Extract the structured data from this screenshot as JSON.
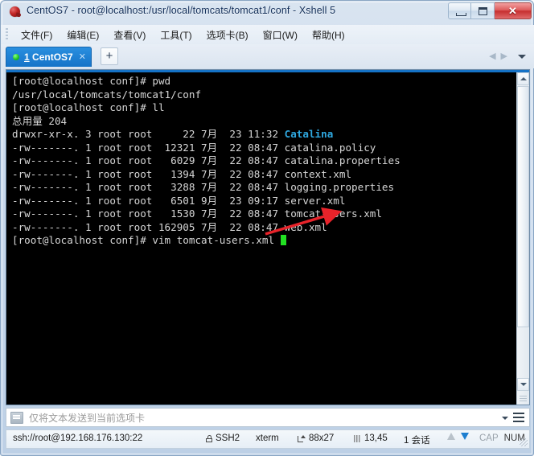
{
  "window": {
    "title": "CentOS7 - root@localhost:/usr/local/tomcats/tomcat1/conf - Xshell 5",
    "icon": "xshell-icon",
    "controls": {
      "minimize": "minimize-button",
      "maximize": "maximize-button",
      "close_label": "✕"
    }
  },
  "menubar": {
    "items": [
      {
        "label": "文件(F)"
      },
      {
        "label": "编辑(E)"
      },
      {
        "label": "查看(V)"
      },
      {
        "label": "工具(T)"
      },
      {
        "label": "选项卡(B)"
      },
      {
        "label": "窗口(W)"
      },
      {
        "label": "帮助(H)"
      }
    ]
  },
  "tabbar": {
    "tabs": [
      {
        "index": "1",
        "label": " CentOS7",
        "close_glyph": "✕",
        "active": true
      }
    ],
    "add_tab_label": "+",
    "nav_prev": "◀",
    "nav_next": "▶"
  },
  "terminal": {
    "lines": [
      "[root@localhost conf]# pwd",
      "/usr/local/tomcats/tomcat1/conf",
      "[root@localhost conf]# ll",
      "总用量 204",
      "drwxr-xr-x. 3 root root     22 7月  23 11:32 ",
      "-rw-------. 1 root root  12321 7月  22 08:47 catalina.policy",
      "-rw-------. 1 root root   6029 7月  22 08:47 catalina.properties",
      "-rw-------. 1 root root   1394 7月  22 08:47 context.xml",
      "-rw-------. 1 root root   3288 7月  22 08:47 logging.properties",
      "-rw-------. 1 root root   6501 9月  23 09:17 server.xml",
      "-rw-------. 1 root root   1530 7月  22 08:47 tomcat-users.xml",
      "-rw-------. 1 root root 162905 7月  22 08:47 web.xml",
      "[root@localhost conf]# vim tomcat-users.xml "
    ],
    "directory_entry": "Catalina",
    "directory_color": "#2fa8e0",
    "foreground_color": "#d6d6d6",
    "background_color": "#000000",
    "cursor_color": "#22e022",
    "annotation_arrow_color": "#e8232a"
  },
  "sendbar": {
    "placeholder": "仅将文本发送到当前选项卡",
    "value": ""
  },
  "statusbar": {
    "url": "ssh://root@192.168.176.130:22",
    "protocol": "SSH2",
    "terminal_type": "xterm",
    "size": "88x27",
    "cursor_position": "13,45",
    "sessions": "1 会话",
    "caps": "CAP",
    "num": "NUM"
  }
}
